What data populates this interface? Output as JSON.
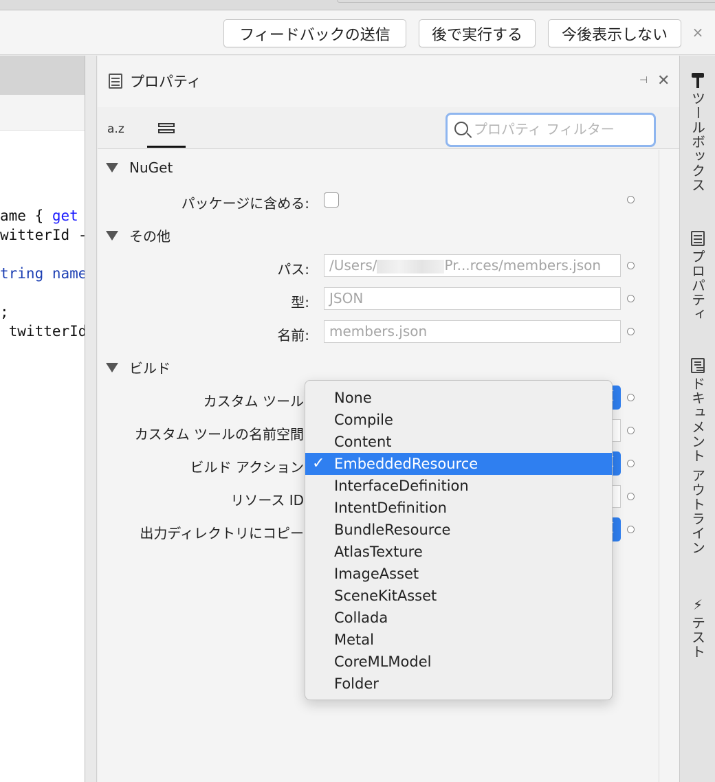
{
  "feedback_bar": {
    "send_feedback": "フィードバックの送信",
    "run_later": "後で実行する",
    "dont_show": "今後表示しない",
    "close": "×"
  },
  "editor": {
    "lines": [
      "ame { get",
      "witterId -",
      "tring name",
      ";",
      " twitterId"
    ]
  },
  "properties": {
    "title": "プロパティ",
    "sort_az": "a.z",
    "search_placeholder": "プロパティ フィルター",
    "categories": {
      "nuget": "NuGet",
      "other": "その他",
      "build": "ビルド"
    },
    "fields": {
      "include_in_package": "パッケージに含める:",
      "path_label": "パス:",
      "path_value_start": "/Users/",
      "path_value_end": "Pr...rces/members.json",
      "type_label": "型:",
      "type_value": "JSON",
      "name_label": "名前:",
      "name_value": "members.json",
      "custom_tool": "カスタム ツール",
      "custom_tool_namespace": "カスタム ツールの名前空間",
      "build_action": "ビルド アクション",
      "resource_id": "リソース ID",
      "copy_to_output": "出力ディレクトリにコピー"
    }
  },
  "build_action_menu": {
    "selected": "EmbeddedResource",
    "check": "✓",
    "options": [
      "None",
      "Compile",
      "Content",
      "EmbeddedResource",
      "InterfaceDefinition",
      "IntentDefinition",
      "BundleResource",
      "AtlasTexture",
      "ImageAsset",
      "SceneKitAsset",
      "Collada",
      "Metal",
      "CoreMLModel",
      "Folder"
    ]
  },
  "dock": {
    "toolbox": "ツールボックス",
    "properties": "プロパティ",
    "document_outline": "ドキュメント アウトライン",
    "test": "テスト"
  }
}
